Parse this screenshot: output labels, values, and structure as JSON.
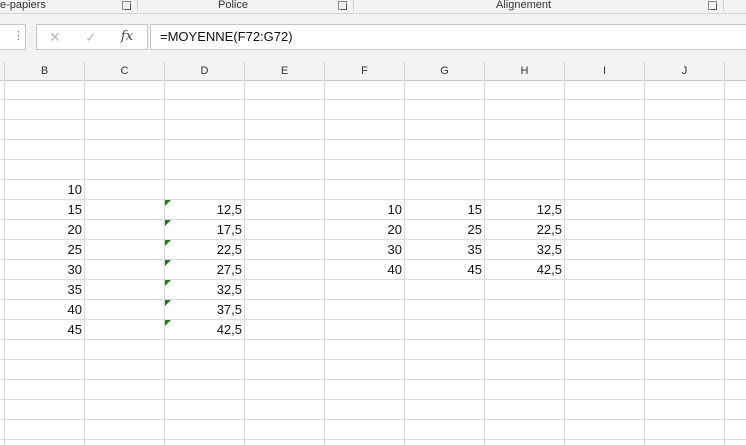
{
  "ribbon": {
    "groups": [
      {
        "label": "e-papiers"
      },
      {
        "label": "Police"
      },
      {
        "label": "Alignement"
      }
    ]
  },
  "formula_bar": {
    "fx_label": "fx",
    "cancel_glyph": "✕",
    "enter_glyph": "✓",
    "more_glyph": "⋮",
    "formula": "=MOYENNE(F72:G72)"
  },
  "columns": [
    "B",
    "C",
    "D",
    "E",
    "F",
    "G",
    "H",
    "I",
    "J"
  ],
  "cells": {
    "B": [
      "10",
      "15",
      "20",
      "25",
      "30",
      "35",
      "40",
      "45"
    ],
    "D": [
      "",
      "12,5",
      "17,5",
      "22,5",
      "27,5",
      "32,5",
      "37,5",
      "42,5"
    ],
    "F": [
      "",
      "10",
      "20",
      "30",
      "40"
    ],
    "G": [
      "",
      "15",
      "25",
      "35",
      "45"
    ],
    "H": [
      "",
      "12,5",
      "22,5",
      "32,5",
      "42,5"
    ]
  },
  "colors": {
    "error_indicator": "#1f7a1f",
    "gridline": "#dadada",
    "header_bg": "#f3f3f3"
  }
}
